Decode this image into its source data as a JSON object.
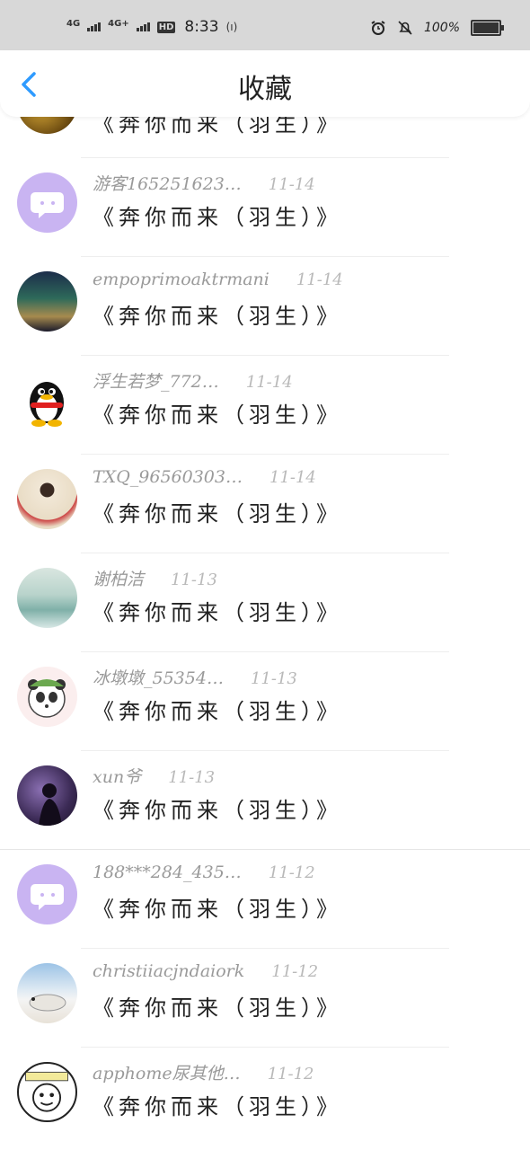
{
  "status_bar": {
    "network1": "4G",
    "network2": "4G+",
    "hd": "HD",
    "time": "8:33",
    "battery": "100%"
  },
  "header": {
    "title": "收藏",
    "back_icon": "chevron-left-icon"
  },
  "colors": {
    "accent": "#2f9bff",
    "chat_avatar_bg": "#c9b4f2",
    "divider": "#eeeeee"
  },
  "items": [
    {
      "name": "",
      "date": "",
      "content": "《奔你而来（羽生）》",
      "avatar": "gold-photo"
    },
    {
      "name": "游客165251623…",
      "date": "11-14",
      "content": "《奔你而来（羽生）》",
      "avatar": "chat-bubble-icon"
    },
    {
      "name": "empoprimoaktrmani",
      "date": "11-14",
      "content": "《奔你而来（羽生）》",
      "avatar": "aurora-photo"
    },
    {
      "name": "浮生若梦_772…",
      "date": "11-14",
      "content": "《奔你而来（羽生）》",
      "avatar": "penguin-icon"
    },
    {
      "name": "TXQ_96560303…",
      "date": "11-14",
      "content": "《奔你而来（羽生）》",
      "avatar": "person-photo"
    },
    {
      "name": "谢柏洁",
      "date": "11-13",
      "content": "《奔你而来（羽生）》",
      "avatar": "lake-photo"
    },
    {
      "name": "冰墩墩_55354…",
      "date": "11-13",
      "content": "《奔你而来（羽生）》",
      "avatar": "panda-photo"
    },
    {
      "name": "xun爷",
      "date": "11-13",
      "content": "《奔你而来（羽生）》",
      "avatar": "silhouette-photo"
    },
    {
      "name": "188***284_435…",
      "date": "11-12",
      "content": "《奔你而来（羽生）》",
      "avatar": "chat-bubble-icon"
    },
    {
      "name": "christiiacjndaiork",
      "date": "11-12",
      "content": "《奔你而来（羽生）》",
      "avatar": "seal-photo"
    },
    {
      "name": "apphome尿其他…",
      "date": "11-12",
      "content": "《奔你而来（羽生）》",
      "avatar": "cartoon-photo"
    }
  ]
}
